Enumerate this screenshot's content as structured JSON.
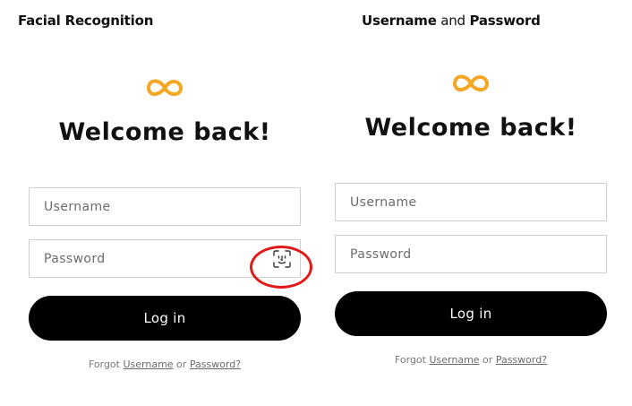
{
  "captions": {
    "left": "Facial Recognition",
    "right_bold_1": "Username",
    "right_mid": " and ",
    "right_bold_2": "Password"
  },
  "brand": {
    "logo_icon": "infinity-icon",
    "color": "#F5A623"
  },
  "screens": [
    {
      "welcome": "Welcome back!",
      "username_placeholder": "Username",
      "password_placeholder": "Password",
      "faceid_icon": "face-id-icon",
      "login_label": "Log in",
      "forgot_prefix": "Forgot ",
      "forgot_username": "Username",
      "forgot_or": " or ",
      "forgot_password": "Password?"
    },
    {
      "welcome": "Welcome back!",
      "username_placeholder": "Username",
      "password_placeholder": "Password",
      "login_label": "Log in",
      "forgot_prefix": "Forgot ",
      "forgot_username": "Username",
      "forgot_or": " or ",
      "forgot_password": "Password?"
    }
  ],
  "highlight_color": "#E01A1A"
}
